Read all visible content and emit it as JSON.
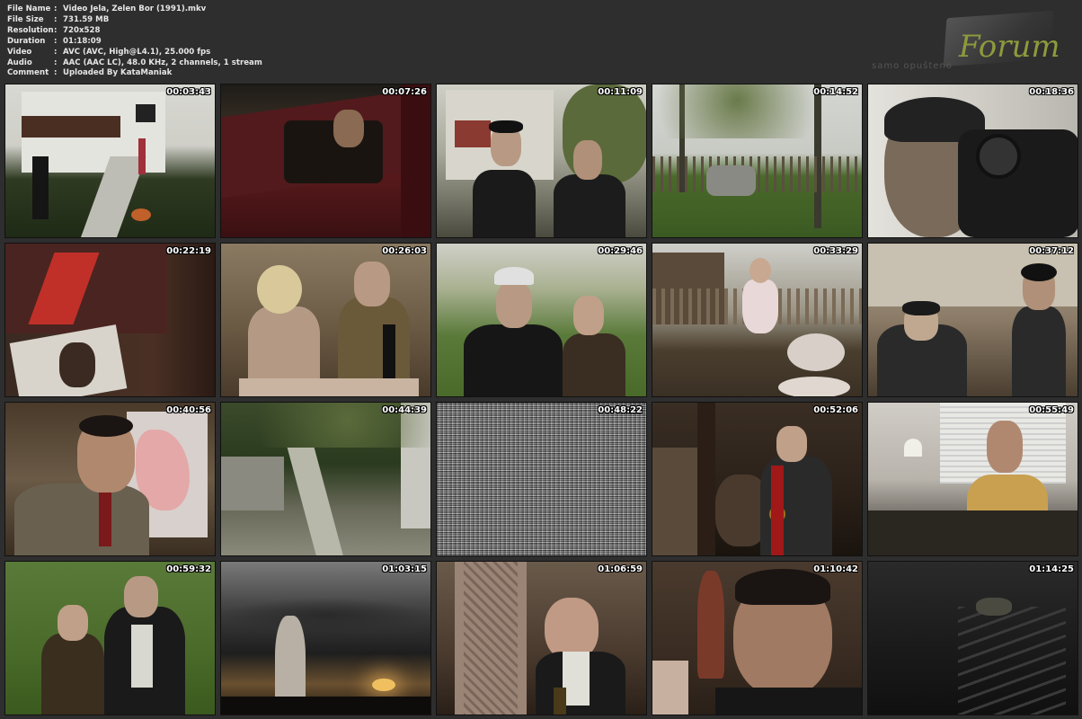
{
  "file_info": [
    {
      "key": "File Name",
      "sep": ":",
      "value": "Video Jela, Zelen Bor (1991).mkv"
    },
    {
      "key": "File Size",
      "sep": ":",
      "value": "731.59 MB"
    },
    {
      "key": "Resolution",
      "sep": ":",
      "value": "720x528"
    },
    {
      "key": "Duration",
      "sep": ":",
      "value": "01:18:09"
    },
    {
      "key": "Video",
      "sep": ":",
      "value": "AVC (AVC, High@L4.1), 25.000 fps"
    },
    {
      "key": "Audio",
      "sep": ":",
      "value": "AAC (AAC LC), 48.0 KHz, 2 channels, 1 stream"
    },
    {
      "key": "Comment",
      "sep": ":",
      "value": "Uploaded By KataManiak"
    }
  ],
  "logo": {
    "text": "Forum",
    "tagline": "samo opušteno"
  },
  "thumbnails": [
    {
      "timestamp": "00:03:43",
      "scene": "house-garden"
    },
    {
      "timestamp": "00:07:26",
      "scene": "man-in-car"
    },
    {
      "timestamp": "00:11:09",
      "scene": "old-couple"
    },
    {
      "timestamp": "00:14:52",
      "scene": "orchard-wreck"
    },
    {
      "timestamp": "00:18:36",
      "scene": "boy-camera"
    },
    {
      "timestamp": "00:22:19",
      "scene": "poster-wall"
    },
    {
      "timestamp": "00:26:03",
      "scene": "couple-dinner"
    },
    {
      "timestamp": "00:29:46",
      "scene": "miner-couple"
    },
    {
      "timestamp": "00:33:29",
      "scene": "girl-pigs"
    },
    {
      "timestamp": "00:37:12",
      "scene": "old-man-boy"
    },
    {
      "timestamp": "00:40:56",
      "scene": "man-map"
    },
    {
      "timestamp": "00:44:39",
      "scene": "path-trees"
    },
    {
      "timestamp": "00:48:22",
      "scene": "static-noise"
    },
    {
      "timestamp": "00:52:06",
      "scene": "man-cow"
    },
    {
      "timestamp": "00:55:49",
      "scene": "man-office"
    },
    {
      "timestamp": "00:59:32",
      "scene": "couple-field"
    },
    {
      "timestamp": "01:03:15",
      "scene": "sunset-figure"
    },
    {
      "timestamp": "01:06:59",
      "scene": "legs-bald-man"
    },
    {
      "timestamp": "01:10:42",
      "scene": "man-bottles"
    },
    {
      "timestamp": "01:14:25",
      "scene": "dark-stairs"
    }
  ],
  "colors": {
    "background": "#2e2e2e",
    "info_text": "#e6e6e6",
    "logo_accent": "#8e9a3c"
  }
}
